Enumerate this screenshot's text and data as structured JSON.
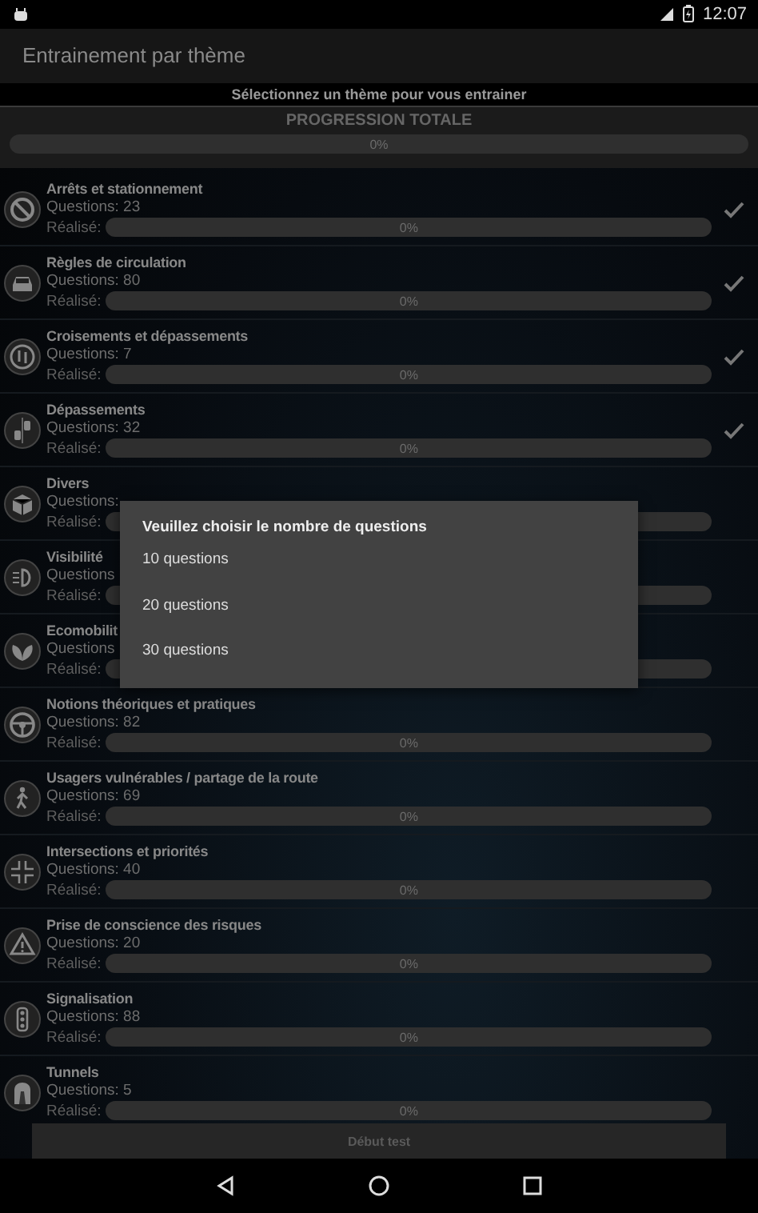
{
  "status_bar": {
    "time": "12:07"
  },
  "app_bar": {
    "title": "Entrainement par thème"
  },
  "subtitle": "Sélectionnez un thème pour vous entrainer",
  "total": {
    "title": "PROGRESSION TOTALE",
    "level": 0,
    "reading": "0%"
  },
  "themes": [
    {
      "title": "Arrêts et stationnement",
      "questions": "Questions: 23",
      "done_label": "Réalisé:",
      "level": 0,
      "reading": "0%",
      "checked": true
    },
    {
      "title": "Règles de circulation",
      "questions": "Questions: 80",
      "done_label": "Réalisé:",
      "level": 0,
      "reading": "0%",
      "checked": true
    },
    {
      "title": "Croisements et dépassements",
      "questions": "Questions: 7",
      "done_label": "Réalisé:",
      "level": 0,
      "reading": "0%",
      "checked": true
    },
    {
      "title": "Dépassements",
      "questions": "Questions: 32",
      "done_label": "Réalisé:",
      "level": 0,
      "reading": "0%",
      "checked": true
    },
    {
      "title": "Divers",
      "questions": "Questions:",
      "done_label": "Réalisé:",
      "level": 0,
      "checked": false
    },
    {
      "title": "Visibilité",
      "questions": "Questions",
      "done_label": "Réalisé:",
      "level": 0,
      "checked": false
    },
    {
      "title": "Ecomobilit",
      "questions": "Questions",
      "done_label": "Réalisé:",
      "level": 0,
      "checked": false
    },
    {
      "title": "Notions théoriques et pratiques",
      "questions": "Questions: 82",
      "done_label": "Réalisé:",
      "level": 0,
      "reading": "0%",
      "checked": false
    },
    {
      "title": "Usagers vulnérables / partage de la route",
      "questions": "Questions: 69",
      "done_label": "Réalisé:",
      "level": 0,
      "reading": "0%",
      "checked": false
    },
    {
      "title": "Intersections et priorités",
      "questions": "Questions: 40",
      "done_label": "Réalisé:",
      "level": 0,
      "reading": "0%",
      "checked": false
    },
    {
      "title": "Prise de conscience des risques",
      "questions": "Questions: 20",
      "done_label": "Réalisé:",
      "level": 0,
      "reading": "0%",
      "checked": false
    },
    {
      "title": "Signalisation",
      "questions": "Questions: 88",
      "done_label": "Réalisé:",
      "level": 0,
      "reading": "0%",
      "checked": false
    },
    {
      "title": "Tunnels",
      "questions": "Questions: 5",
      "done_label": "Réalisé:",
      "level": 0,
      "reading": "0%",
      "checked": false
    }
  ],
  "start_button": "Début test",
  "dialog": {
    "title": "Veuillez choisir le nombre de questions",
    "options": [
      "10 questions",
      "20 questions",
      "30 questions"
    ]
  }
}
